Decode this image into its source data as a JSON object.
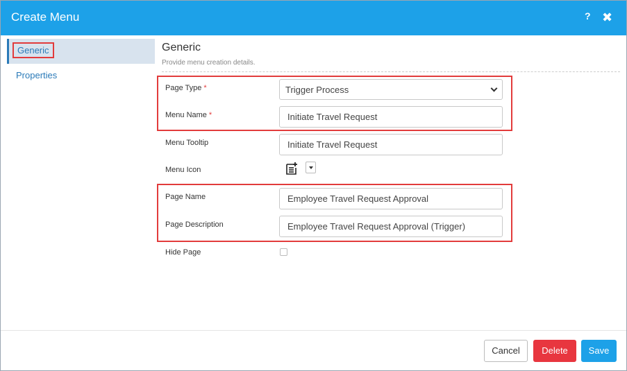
{
  "dialog": {
    "title": "Create Menu",
    "help": "?",
    "close": "✖"
  },
  "sidebar": {
    "items": [
      {
        "label": "Generic",
        "active": true
      },
      {
        "label": "Properties",
        "active": false
      }
    ]
  },
  "section": {
    "title": "Generic",
    "description": "Provide menu creation details."
  },
  "form": {
    "page_type": {
      "label": "Page Type",
      "required": "*",
      "value": "Trigger Process"
    },
    "menu_name": {
      "label": "Menu Name",
      "required": "*",
      "value": "Initiate Travel Request"
    },
    "menu_tooltip": {
      "label": "Menu Tooltip",
      "value": "Initiate Travel Request"
    },
    "menu_icon": {
      "label": "Menu Icon",
      "icon": "list-add-icon"
    },
    "page_name": {
      "label": "Page Name",
      "value": "Employee Travel Request Approval"
    },
    "page_description": {
      "label": "Page Description",
      "value": "Employee Travel Request Approval (Trigger)"
    },
    "hide_page": {
      "label": "Hide Page",
      "checked": false
    }
  },
  "footer": {
    "cancel_label": "Cancel",
    "delete_label": "Delete",
    "save_label": "Save"
  },
  "colors": {
    "header": "#1da1e8",
    "delete": "#e8363f",
    "save": "#1da1e8",
    "highlight": "#e23b3b",
    "link": "#2a7ab8"
  }
}
